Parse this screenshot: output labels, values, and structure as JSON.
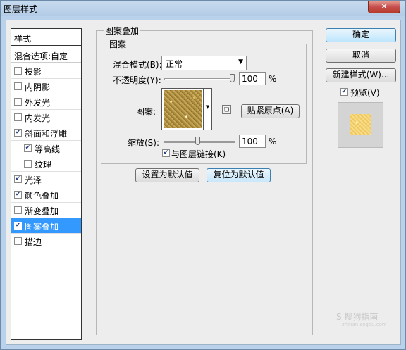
{
  "window": {
    "title": "图层样式",
    "close_label": "✕"
  },
  "styles_panel": {
    "header": "样式",
    "blend_options": "混合选项:自定",
    "items": [
      {
        "label": "投影",
        "checked": false,
        "indent": false,
        "selected": false
      },
      {
        "label": "内阴影",
        "checked": false,
        "indent": false,
        "selected": false
      },
      {
        "label": "外发光",
        "checked": false,
        "indent": false,
        "selected": false
      },
      {
        "label": "内发光",
        "checked": false,
        "indent": false,
        "selected": false
      },
      {
        "label": "斜面和浮雕",
        "checked": true,
        "indent": false,
        "selected": false
      },
      {
        "label": "等高线",
        "checked": true,
        "indent": true,
        "selected": false
      },
      {
        "label": "纹理",
        "checked": false,
        "indent": true,
        "selected": false
      },
      {
        "label": "光泽",
        "checked": true,
        "indent": false,
        "selected": false
      },
      {
        "label": "颜色叠加",
        "checked": true,
        "indent": false,
        "selected": false
      },
      {
        "label": "渐变叠加",
        "checked": false,
        "indent": false,
        "selected": false
      },
      {
        "label": "图案叠加",
        "checked": true,
        "indent": false,
        "selected": true
      },
      {
        "label": "描边",
        "checked": false,
        "indent": false,
        "selected": false
      }
    ]
  },
  "pattern_overlay": {
    "group_title": "图案叠加",
    "subgroup_title": "图案",
    "blend_mode_label": "混合模式(B):",
    "blend_mode_value": "正常",
    "opacity_label": "不透明度(Y):",
    "opacity_value": "100",
    "opacity_unit": "%",
    "pattern_label": "图案:",
    "snap_origin_button": "贴紧原点(A)",
    "scale_label": "缩放(S):",
    "scale_value": "100",
    "scale_unit": "%",
    "link_with_layer_label": "与图层链接(K)",
    "link_with_layer_checked": true,
    "make_default_button": "设置为默认值",
    "reset_default_button": "复位为默认值"
  },
  "actions": {
    "ok_button": "确定",
    "cancel_button": "取消",
    "new_style_button": "新建样式(W)...",
    "preview_label": "预览(V)",
    "preview_checked": true
  },
  "watermark": {
    "text": "S 搜狗指南",
    "sub": "zhinan.sogou.com"
  }
}
